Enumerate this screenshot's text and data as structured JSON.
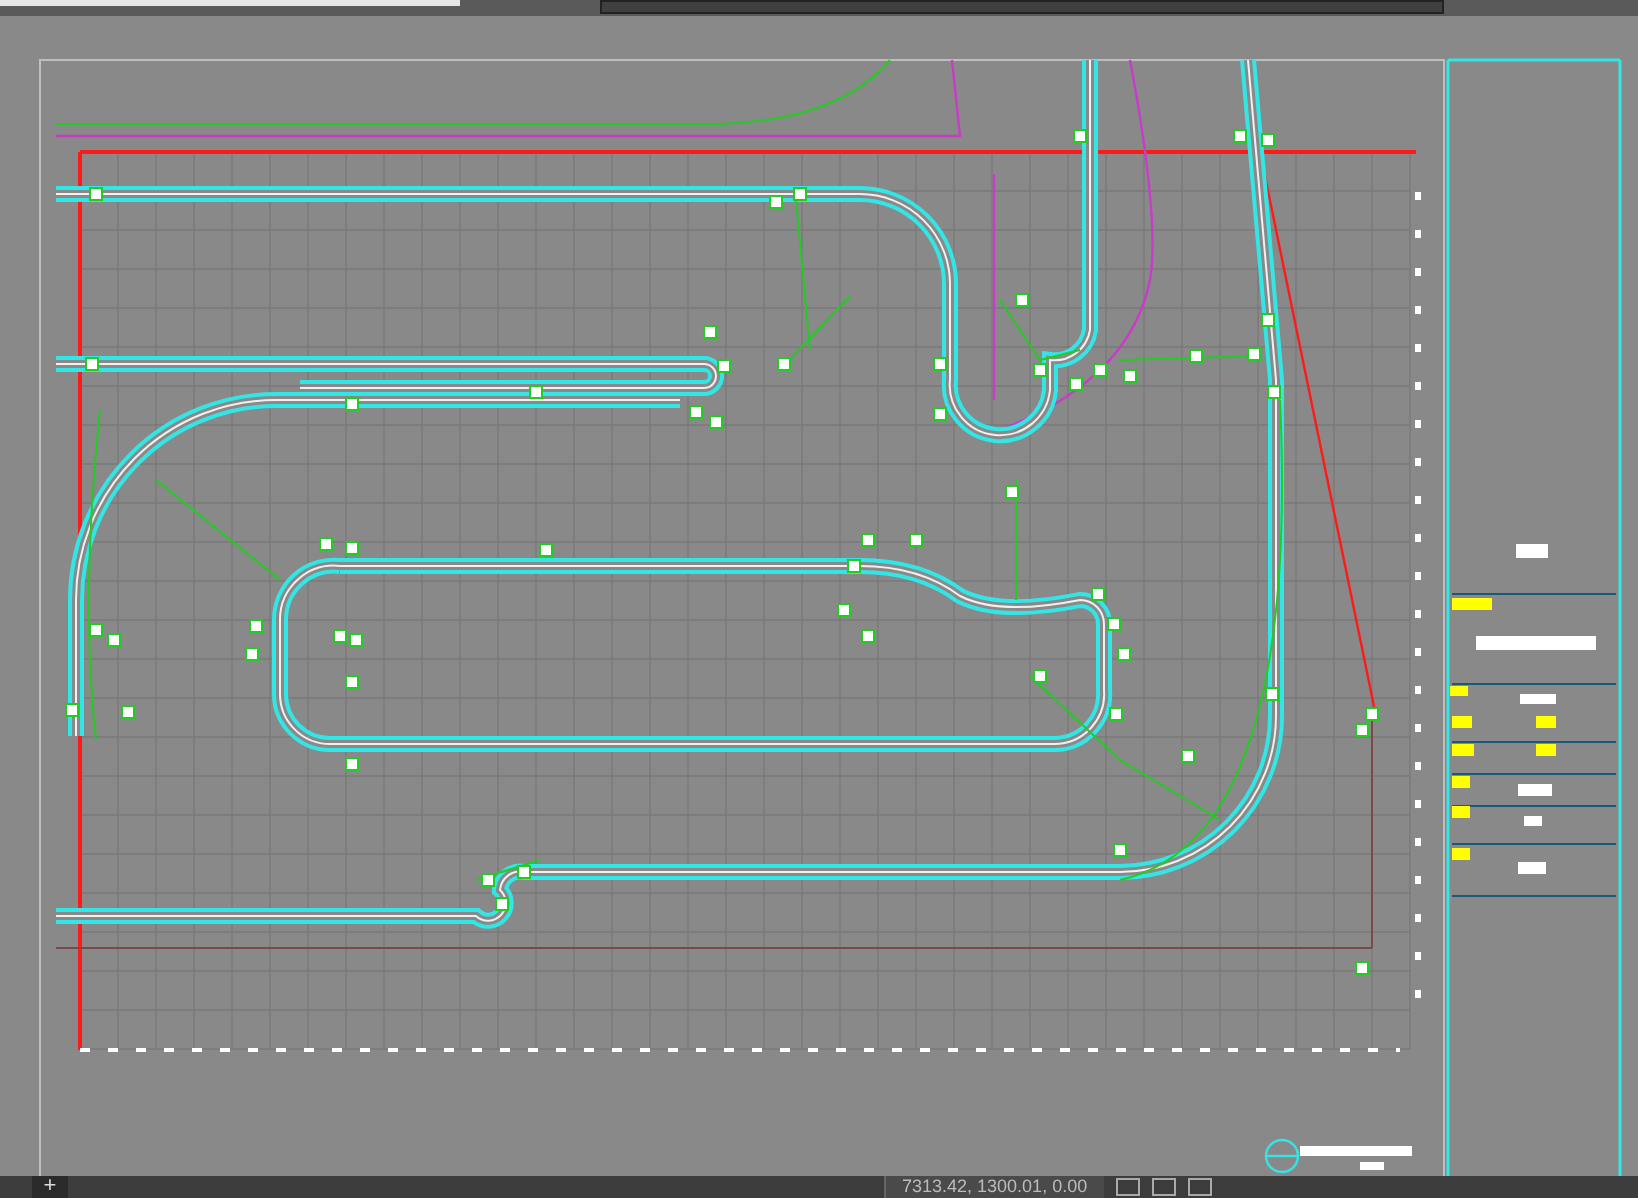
{
  "layout_tabs": {
    "add_button": "+"
  },
  "status_bar": {
    "coordinates": "7313.42, 1300.01, 0.00"
  }
}
